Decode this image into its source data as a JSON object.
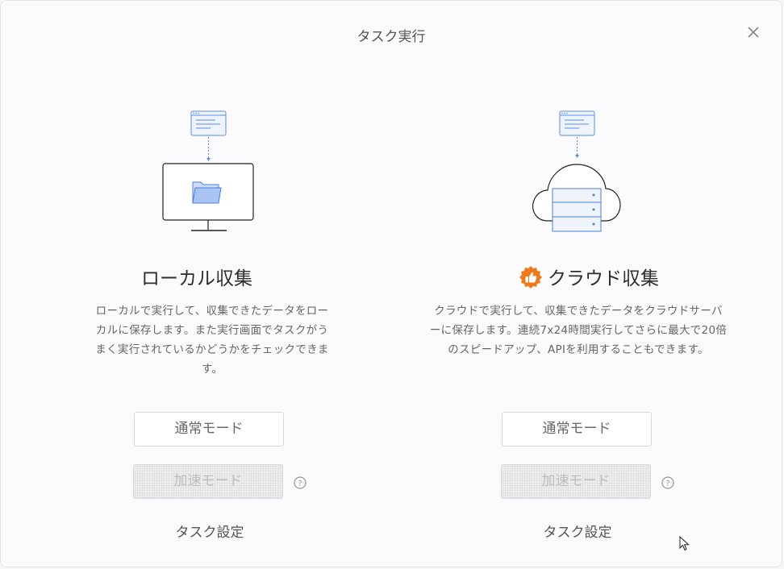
{
  "dialog": {
    "title": "タスク実行"
  },
  "local": {
    "heading": "ローカル収集",
    "description": "ローカルで実行して、収集できたデータをローカルに保存します。また実行画面でタスクがうまく実行されているかどうかをチェックできます。",
    "normal_mode": "通常モード",
    "fast_mode": "加速モード",
    "task_settings": "タスク設定"
  },
  "cloud": {
    "heading": "クラウド収集",
    "description_lines": [
      "クラウドで実行して、収集できたデータをクラウドサーバ",
      "ーに保存します。連続7x24時間実行してさらに最大で20倍",
      "のスピードアップ、APIを利用することもできます。"
    ],
    "normal_mode": "通常モード",
    "fast_mode": "加速モード",
    "task_settings": "タスク設定"
  },
  "colors": {
    "accent_blue": "#4a7fe0",
    "badge_orange": "#f07a1a"
  }
}
